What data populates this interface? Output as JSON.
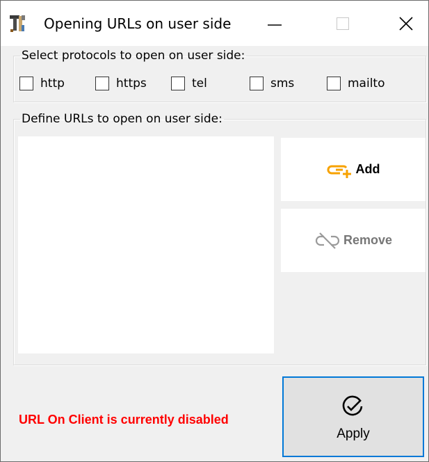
{
  "window": {
    "title": "Opening URLs on user side"
  },
  "icons": {
    "app": "tools-icon",
    "minimize": "minimize-icon",
    "maximize": "maximize-icon",
    "close": "close-icon",
    "add": "link-add-icon",
    "remove": "link-remove-icon",
    "apply": "check-circle-icon"
  },
  "protocols": {
    "legend": "Select protocols to open on user side:",
    "items": [
      {
        "label": "http",
        "checked": false
      },
      {
        "label": "https",
        "checked": false
      },
      {
        "label": "tel",
        "checked": false
      },
      {
        "label": "sms",
        "checked": false
      },
      {
        "label": "mailto",
        "checked": false
      }
    ]
  },
  "urls": {
    "legend": "Define URLs to open on user side:",
    "entries": [],
    "add_label": "Add",
    "remove_label": "Remove"
  },
  "footer": {
    "status": "URL On Client is currently disabled",
    "apply_label": "Apply"
  },
  "colors": {
    "accent": "#0078d7",
    "add_icon": "#f7a200",
    "status": "#ff0000",
    "disabled": "#8a8a8a"
  }
}
